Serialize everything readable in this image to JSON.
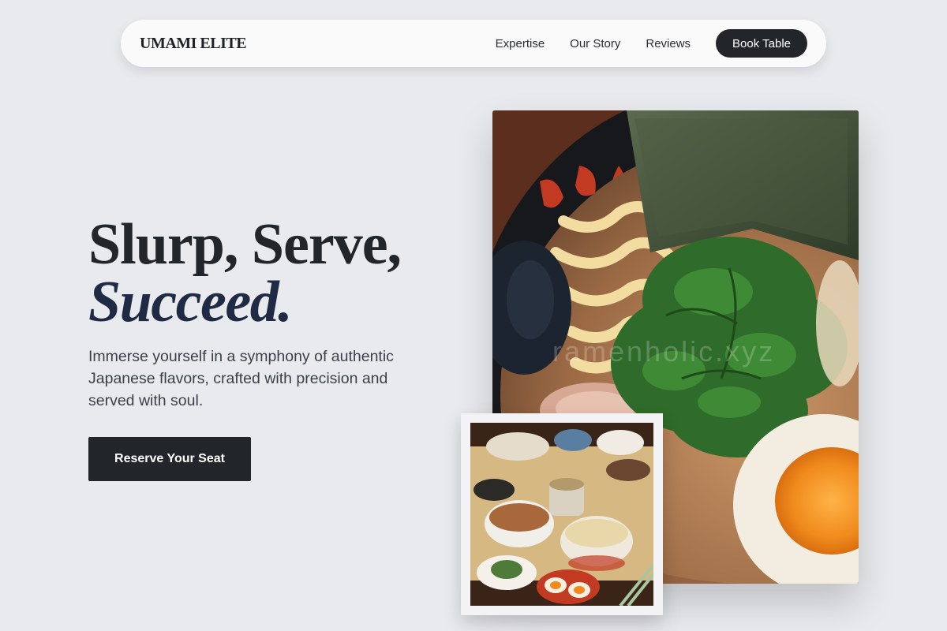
{
  "nav": {
    "brand": "UMAMI ELITE",
    "links": [
      "Expertise",
      "Our Story",
      "Reviews"
    ],
    "cta": "Book Table"
  },
  "hero": {
    "headline_line1": "Slurp, Serve,",
    "headline_line2": "Succeed.",
    "description": "Immerse yourself in a symphony of authentic Japanese flavors, crafted with precision and served with soul.",
    "cta": "Reserve Your Seat"
  },
  "images": {
    "main": "ramen-bowl-photo",
    "secondary": "japanese-table-spread-photo",
    "watermark": "ramenholic.xyz"
  },
  "colors": {
    "background": "#e9eaee",
    "primary_dark": "#22262b",
    "accent_navy": "#1f2a44"
  }
}
